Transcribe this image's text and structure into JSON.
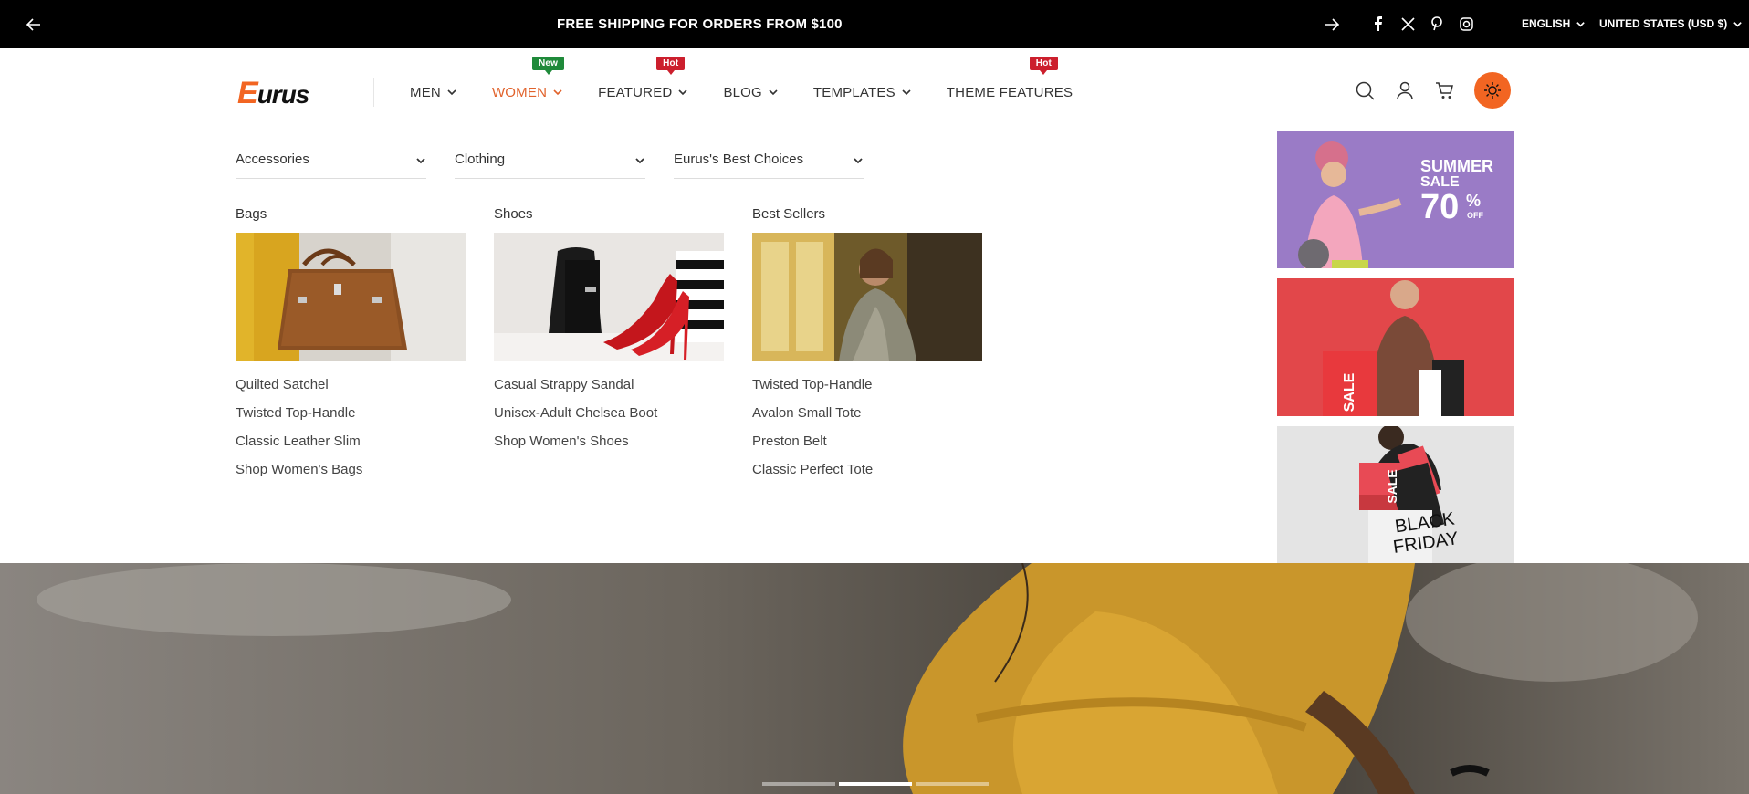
{
  "topbar": {
    "announcement": "FREE SHIPPING FOR ORDERS FROM $100",
    "language": "ENGLISH",
    "currency": "UNITED STATES (USD $)",
    "social": [
      "facebook-icon",
      "x-icon",
      "pinterest-icon",
      "instagram-icon"
    ]
  },
  "header": {
    "logo_e": "E",
    "logo_rest": "urus",
    "nav": [
      {
        "label": "MEN",
        "badge": ""
      },
      {
        "label": "WOMEN",
        "badge": "New"
      },
      {
        "label": "FEATURED",
        "badge": "Hot"
      },
      {
        "label": "BLOG",
        "badge": ""
      },
      {
        "label": "TEMPLATES",
        "badge": ""
      },
      {
        "label": "THEME FEATURES",
        "badge": "Hot"
      }
    ]
  },
  "mega": {
    "tabs": [
      "Accessories",
      "Clothing",
      "Eurus's Best Choices"
    ],
    "columns": [
      {
        "title": "Bags",
        "links": [
          "Quilted Satchel",
          "Twisted Top-Handle",
          "Classic Leather Slim",
          "Shop Women's Bags"
        ]
      },
      {
        "title": "Shoes",
        "links": [
          "Casual Strappy Sandal",
          "Unisex-Adult Chelsea Boot",
          "Shop Women's Shoes"
        ]
      },
      {
        "title": "Best Sellers",
        "links": [
          "Twisted Top-Handle",
          "Avalon Small Tote",
          "Preston Belt",
          "Classic Perfect Tote"
        ]
      }
    ],
    "promos": {
      "summer_line1": "SUMMER",
      "summer_line2": "SALE",
      "summer_pct": "70",
      "summer_pct_sign": "%",
      "summer_off": "OFF",
      "sale_word": "SALE",
      "bf_sale": "SALE",
      "bf_line1": "BLACK",
      "bf_line2": "FRIDAY"
    }
  },
  "colors": {
    "accent": "#f26522",
    "active_nav": "#e1622b",
    "badge_new": "#1f8a3a",
    "badge_hot": "#cc1f2d"
  }
}
